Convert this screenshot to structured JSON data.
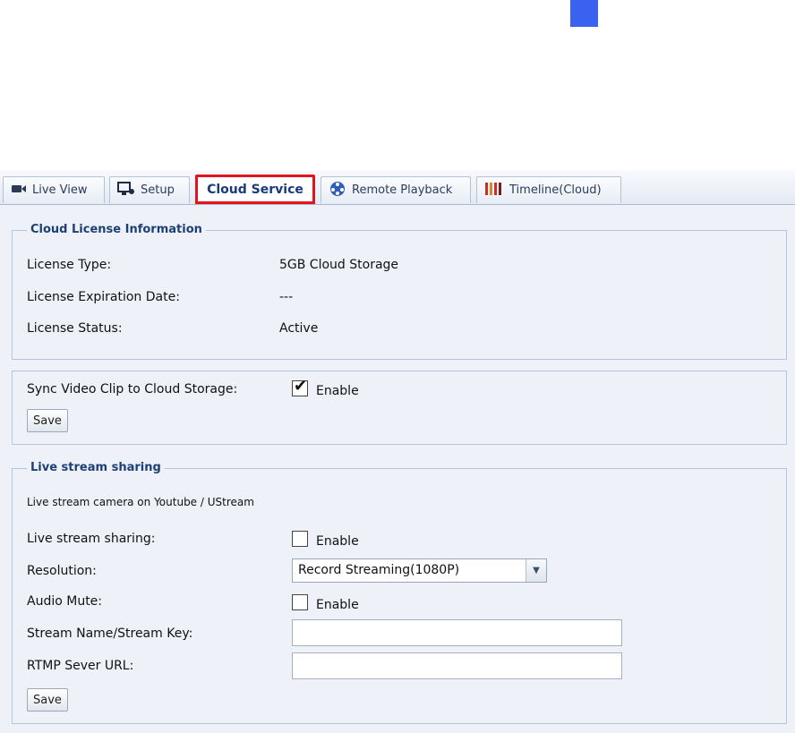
{
  "colors": {
    "accent_mark": "#3a62f0",
    "active_tab_outline": "#e4121a",
    "section_title": "#1d3f78"
  },
  "tabs": [
    {
      "label": "Live View",
      "icon": "camera-icon"
    },
    {
      "label": "Setup",
      "icon": "setup-monitor-icon"
    },
    {
      "label": "Cloud Service",
      "active": true
    },
    {
      "label": "Remote Playback",
      "icon": "film-reel-icon"
    },
    {
      "label": "Timeline(Cloud)",
      "icon": "timeline-bars-icon"
    }
  ],
  "license": {
    "title": "Cloud License Information",
    "rows": [
      {
        "label": "License Type:",
        "value": "5GB Cloud Storage"
      },
      {
        "label": "License Expiration Date:",
        "value": "---"
      },
      {
        "label": "License Status:",
        "value": "Active"
      }
    ]
  },
  "sync": {
    "label": "Sync Video Clip to Cloud Storage:",
    "enable_label": "Enable",
    "checked": true,
    "save_label": "Save"
  },
  "stream": {
    "title": "Live stream sharing",
    "description": "Live stream camera on Youtube / UStream",
    "sharing_label": "Live stream sharing:",
    "sharing_enable": "Enable",
    "resolution_label": "Resolution:",
    "resolution_value": "Record Streaming(1080P)",
    "audio_label": "Audio Mute:",
    "audio_enable": "Enable",
    "stream_key_label": "Stream Name/Stream Key:",
    "rtmp_label": "RTMP Sever URL:",
    "save_label": "Save"
  }
}
